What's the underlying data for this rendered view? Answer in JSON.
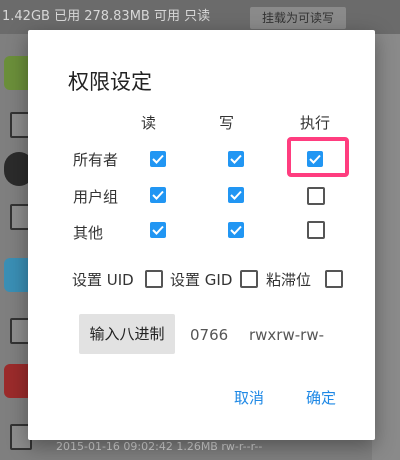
{
  "background": {
    "status_text": "1.42GB 已用  278.83MB 可用  只读",
    "button_label": "挂载为可读写",
    "footer_text": "2015-01-16 09:02:42  1.26MB  rw-r--r--"
  },
  "dialog": {
    "title": "权限设定",
    "columns": [
      "读",
      "写",
      "执行"
    ],
    "rows": [
      {
        "label": "所有者",
        "read": true,
        "write": true,
        "execute": true
      },
      {
        "label": "用户组",
        "read": true,
        "write": true,
        "execute": false
      },
      {
        "label": "其他",
        "read": true,
        "write": true,
        "execute": false
      }
    ],
    "flags": {
      "uid_label": "设置 UID",
      "uid_checked": false,
      "gid_label": "设置 GID",
      "gid_checked": false,
      "sticky_label": "粘滞位",
      "sticky_checked": false
    },
    "octal_button_label": "输入八进制",
    "octal_value": "0766",
    "symbolic_value": "rwxrw-rw-",
    "cancel_label": "取消",
    "ok_label": "确定"
  },
  "colors": {
    "accent": "#2196f3",
    "highlight": "#ff3d7f",
    "action_text": "#1e88e5"
  }
}
